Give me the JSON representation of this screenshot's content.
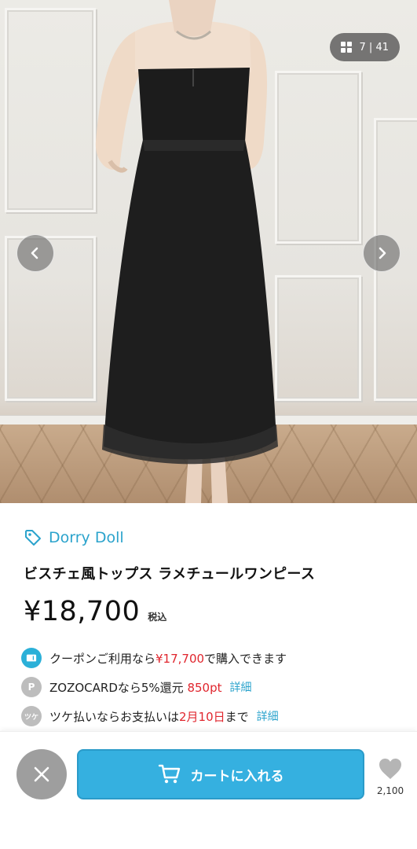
{
  "gallery": {
    "counter_current": "7",
    "counter_total": "41",
    "icons": {
      "grid": "grid-icon",
      "prev": "chevron-left-icon",
      "next": "chevron-right-icon"
    }
  },
  "product": {
    "brand": "Dorry Doll",
    "brand_icon": "tag-icon",
    "title": "ビスチェ風トップス ラメチュールワンピース",
    "price": "¥18,700",
    "tax_label": "税込"
  },
  "benefits": {
    "coupon": {
      "icon": "coupon-icon",
      "prefix": "クーポンご利用なら",
      "amount": "¥17,700",
      "suffix": "で購入できます"
    },
    "zozocard": {
      "icon_text": "P",
      "prefix": "ZOZOCARDなら5%還元 ",
      "points": "850pt",
      "link": "詳細"
    },
    "tsuke": {
      "icon_text": "ツケ",
      "prefix": "ツケ払いならお支払いは",
      "date": "2月10日",
      "suffix": "まで",
      "link": "詳細"
    }
  },
  "bottom_bar": {
    "close_icon": "close-icon",
    "cart_label": "カートに入れる",
    "cart_icon": "cart-icon",
    "favorite_icon": "heart-icon",
    "favorite_count": "2,100"
  },
  "colors": {
    "accent": "#35b0e0",
    "brand_link": "#2ba3cc",
    "price_highlight": "#e0262e",
    "close_button": "#9e9e9e"
  }
}
